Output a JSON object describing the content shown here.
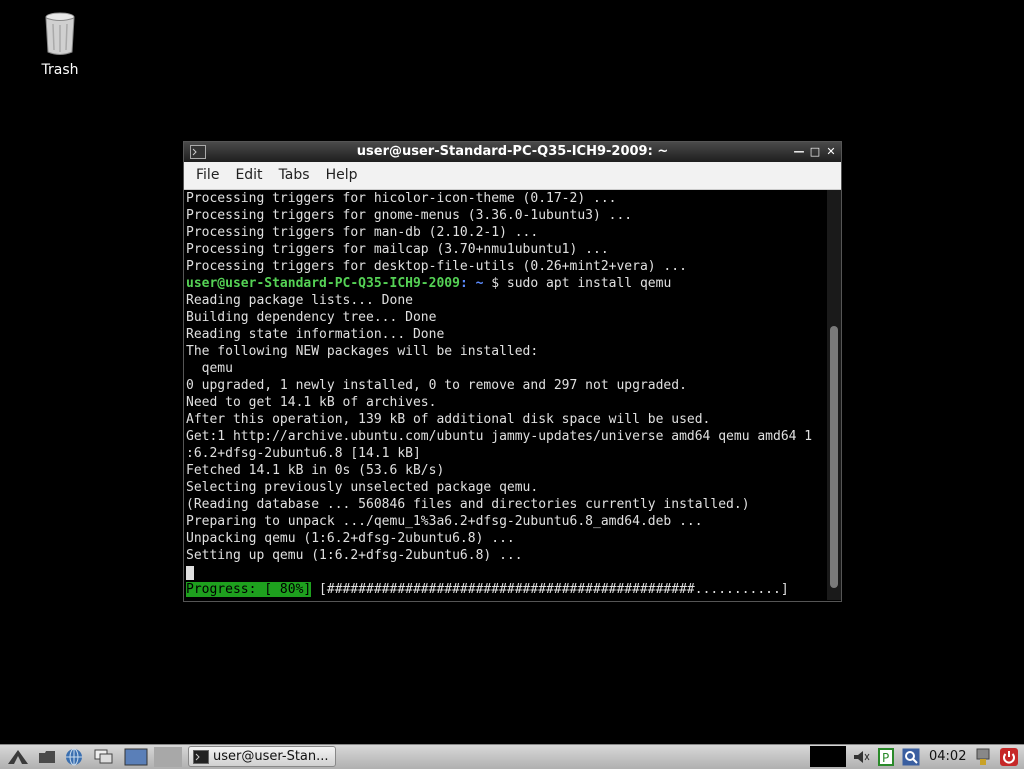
{
  "desktop": {
    "icons": [
      {
        "label": "Trash"
      }
    ]
  },
  "window": {
    "title": "user@user-Standard-PC-Q35-ICH9-2009: ~",
    "menu": [
      "File",
      "Edit",
      "Tabs",
      "Help"
    ]
  },
  "terminal": {
    "lines": [
      "Processing triggers for hicolor-icon-theme (0.17-2) ...",
      "Processing triggers for gnome-menus (3.36.0-1ubuntu3) ...",
      "Processing triggers for man-db (2.10.2-1) ...",
      "Processing triggers for mailcap (3.70+nmu1ubuntu1) ...",
      "Processing triggers for desktop-file-utils (0.26+mint2+vera) ..."
    ],
    "prompt": {
      "user_host": "user@user-Standard-PC-Q35-ICH9-2009",
      "path": ": ~",
      "symbol": " $ ",
      "command": "sudo apt install qemu"
    },
    "output": [
      "Reading package lists... Done",
      "Building dependency tree... Done",
      "Reading state information... Done",
      "The following NEW packages will be installed:",
      "  qemu",
      "0 upgraded, 1 newly installed, 0 to remove and 297 not upgraded.",
      "Need to get 14.1 kB of archives.",
      "After this operation, 139 kB of additional disk space will be used.",
      "Get:1 http://archive.ubuntu.com/ubuntu jammy-updates/universe amd64 qemu amd64 1",
      ":6.2+dfsg-2ubuntu6.8 [14.1 kB]",
      "Fetched 14.1 kB in 0s (53.6 kB/s)",
      "Selecting previously unselected package qemu.",
      "(Reading database ... 560846 files and directories currently installed.)",
      "Preparing to unpack .../qemu_1%3a6.2+dfsg-2ubuntu6.8_amd64.deb ...",
      "Unpacking qemu (1:6.2+dfsg-2ubuntu6.8) ...",
      "Setting up qemu (1:6.2+dfsg-2ubuntu6.8) ..."
    ],
    "progress": {
      "label": "Progress: [ 80%]",
      "bar": " [###############################################...........]"
    },
    "scroll_fraction": 0.65
  },
  "taskbar": {
    "task_label": "user@user-Stan...",
    "clock": "04:02"
  },
  "colors": {
    "prompt_user": "#55d255",
    "prompt_path": "#5c8cff",
    "progress_bg": "#1ea01e"
  }
}
